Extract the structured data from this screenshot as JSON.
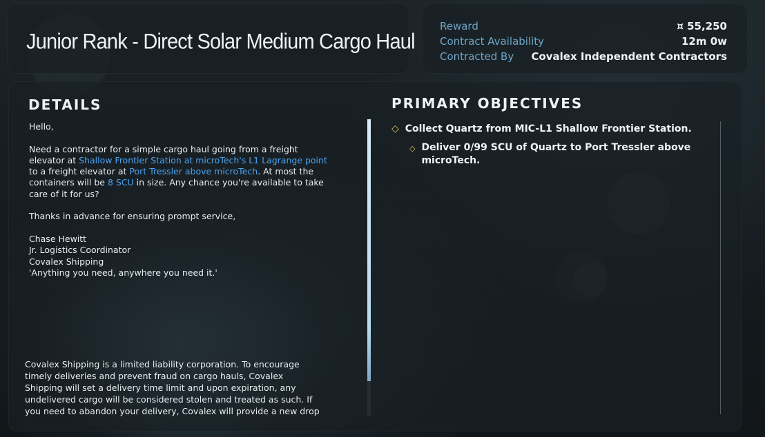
{
  "title_panel": {
    "title": "Junior Rank - Direct Solar Medium Cargo Haul"
  },
  "info_panel": {
    "reward_label": "Reward",
    "reward_value": "¤ 55,250",
    "availability_label": "Contract Availability",
    "availability_value": "12m 0w",
    "contracted_by_label": "Contracted By",
    "contracted_by_value": "Covalex Independent Contractors"
  },
  "details": {
    "heading": "DETAILS",
    "greeting": "Hello,",
    "p2_part1": "Need a contractor for a simple cargo haul going from a freight elevator at ",
    "p2_link1": "Shallow Frontier Station at microTech's L1 Lagrange point",
    "p2_part2": " to a freight elevator at ",
    "p2_link2": "Port Tressler above microTech",
    "p2_part3": ". At most the containers will be ",
    "p2_link3": "8 SCU",
    "p2_part4": " in size. Any chance you're available to take care of it for us?",
    "thanks": "Thanks in advance for ensuring prompt service,",
    "sig_name": "Chase Hewitt",
    "sig_title": "Jr. Logistics Coordinator",
    "sig_company": "Covalex Shipping",
    "sig_motto": "'Anything you need, anywhere you need it.'",
    "legal": "Covalex Shipping is a limited liability corporation. To encourage timely deliveries and prevent fraud on cargo hauls, Covalex Shipping will set a delivery time limit and upon expiration, any undelivered cargo will be considered stolen and treated as such. If you need to abandon your delivery, Covalex will provide a new drop"
  },
  "objectives": {
    "heading": "PRIMARY OBJECTIVES",
    "items": [
      {
        "text": "Collect Quartz from MIC-L1 Shallow Frontier Station."
      },
      {
        "text": "Deliver 0/99 SCU of Quartz to Port Tressler above microTech."
      }
    ]
  },
  "colors": {
    "accent_link": "#4ca3f0",
    "label_blue": "#6fa6c8",
    "objective_marker": "#e2c35a"
  },
  "icons": {
    "currency": "auec-currency-icon",
    "objective_marker": "diamond-icon"
  }
}
